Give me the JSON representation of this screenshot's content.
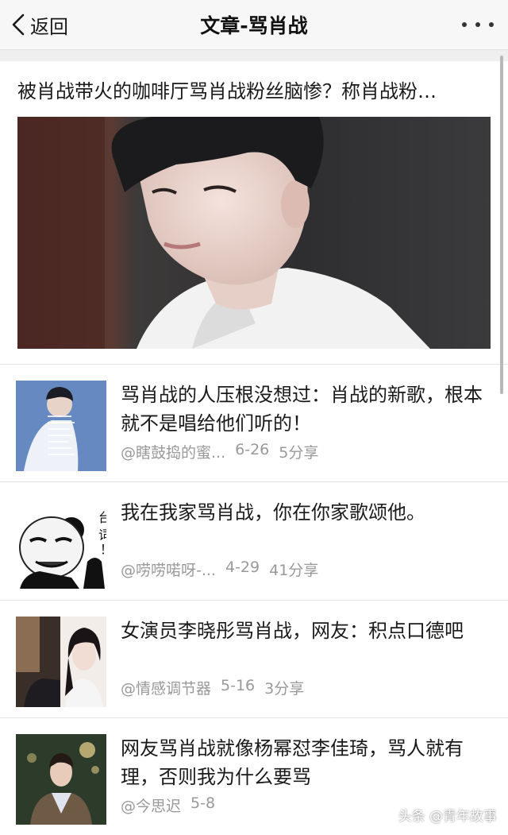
{
  "header": {
    "back_label": "返回",
    "title": "文章-骂肖战"
  },
  "featured": {
    "title": "被肖战带火的咖啡厅骂肖战粉丝脑惨？称肖战粉…"
  },
  "items": [
    {
      "title": "骂肖战的人压根没想过：肖战的新歌，根本就不是唱给他们听的！",
      "source": "@瞎鼓捣的蜜...",
      "date": "6-26",
      "shares": "5分享"
    },
    {
      "title": "我在我家骂肖战，你在你家歌颂他。",
      "source": "@唠唠喏呀-...",
      "date": "4-29",
      "shares": "41分享",
      "thumb_text": "台词！"
    },
    {
      "title": "女演员李晓彤骂肖战，网友：积点口德吧",
      "source": "@情感调节器",
      "date": "5-16",
      "shares": "3分享"
    },
    {
      "title": "网友骂肖战就像杨幂怼李佳琦，骂人就有理，否则我为什么要骂",
      "source": "@今思迟",
      "date": "5-8",
      "shares": ""
    }
  ],
  "watermark": "头条 @青年故事",
  "colors": {
    "header_bg": "#f7f7f7",
    "meta_text": "#999999",
    "divider": "#e3e3e3"
  }
}
